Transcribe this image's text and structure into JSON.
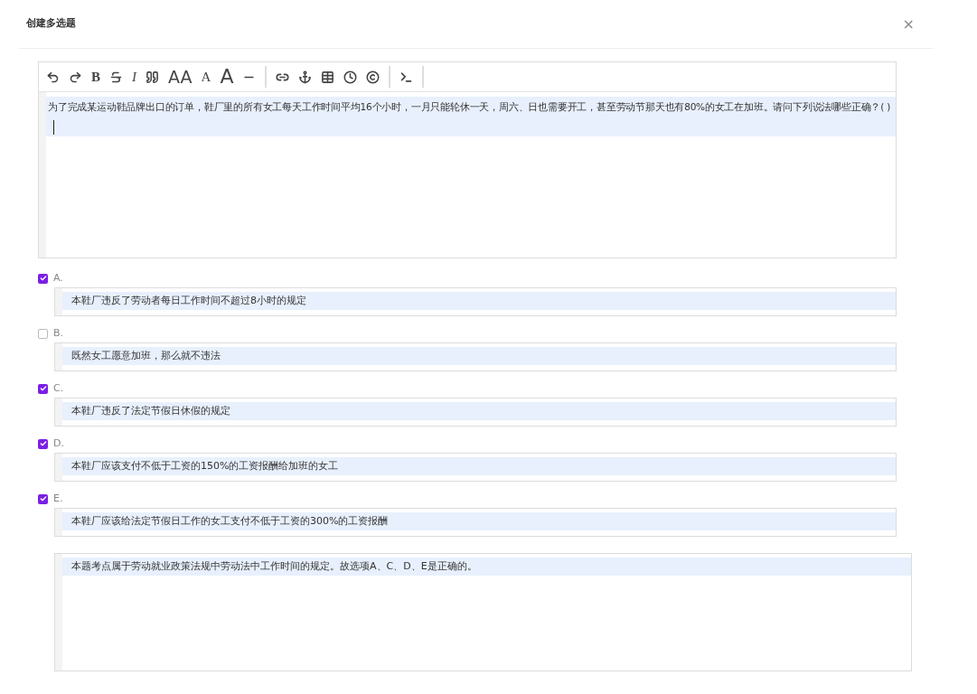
{
  "dialog": {
    "title": "创建多选题",
    "close": "×"
  },
  "editor": {
    "toolbar": [
      {
        "kind": "icon"
      },
      {
        "kind": "icon"
      },
      {
        "kind": "glyph",
        "label": "B"
      },
      {
        "kind": "icon"
      },
      {
        "kind": "glyph",
        "label": "I"
      },
      {
        "kind": "icon"
      },
      {
        "kind": "glyph",
        "label": "AA"
      },
      {
        "kind": "glyph",
        "label": "A"
      },
      {
        "kind": "glyph",
        "label": "A"
      },
      {
        "kind": "icon"
      },
      {
        "kind": "separator"
      },
      {
        "kind": "icon"
      },
      {
        "kind": "icon"
      },
      {
        "kind": "icon"
      },
      {
        "kind": "icon"
      },
      {
        "kind": "icon"
      },
      {
        "kind": "separator"
      },
      {
        "kind": "icon"
      },
      {
        "kind": "separator"
      }
    ],
    "content": "为了完成某运动鞋品牌出口的订单，鞋厂里的所有女工每天工作时间平均16个小时，一月只能轮休一天，周六、日也需要开工，甚至劳动节那天也有80%的女工在加班。请问下列说法哪些正确？( )"
  },
  "options": [
    {
      "label": "A.",
      "checked": true,
      "text": "本鞋厂违反了劳动者每日工作时间不超过8小时的规定"
    },
    {
      "label": "B.",
      "checked": false,
      "text": "既然女工愿意加班，那么就不违法"
    },
    {
      "label": "C.",
      "checked": true,
      "text": "本鞋厂违反了法定节假日休假的规定"
    },
    {
      "label": "D.",
      "checked": true,
      "text": "本鞋厂应该支付不低于工资的150%的工资报酬给加班的女工"
    },
    {
      "label": "E.",
      "checked": true,
      "text": "本鞋厂应该给法定节假日工作的女工支付不低于工资的300%的工资报酬"
    }
  ],
  "analysis": "本题考点属于劳动就业政策法规中劳动法中工作时间的规定。故选项A、C、D、E是正确的。"
}
